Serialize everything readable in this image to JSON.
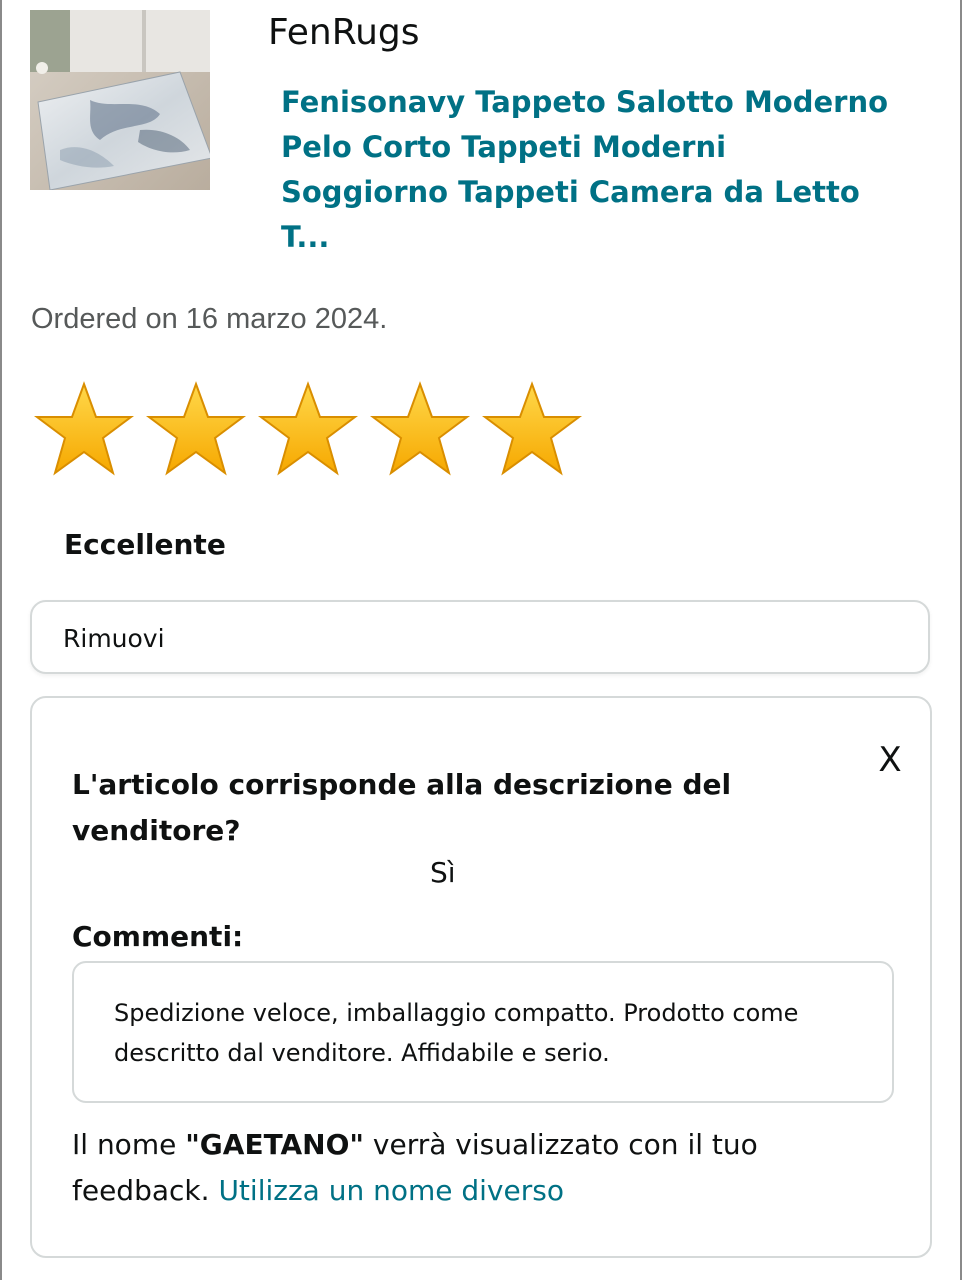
{
  "product": {
    "seller": "FenRugs",
    "title": "Fenisonavy Tappeto Salotto Moderno Pelo Corto Tappeti Moderni Soggiorno Tappeti Camera da Letto T..."
  },
  "order": {
    "date_text": "Ordered on 16 marzo 2024."
  },
  "rating": {
    "value": 5,
    "max": 5,
    "label": "Eccellente",
    "star_color": "#FFB400"
  },
  "actions": {
    "remove_label": "Rimuovi"
  },
  "feedback": {
    "close_label": "X",
    "question": "L'articolo corrisponde alla descrizione del venditore?",
    "answer": "Sì",
    "comments_label": "Commenti:",
    "comment_text": "Spedizione veloce, imballaggio compatto. Prodotto come descritto dal venditore. Affidabile e serio.",
    "name_prefix": "Il nome ",
    "name_value": "\"GAETANO\"",
    "name_suffix": " verrà visualizzato con il tuo feedback. ",
    "change_name_link": "Utilizza un nome diverso"
  },
  "colors": {
    "link": "#007185",
    "text": "#0f1111",
    "muted": "#565959",
    "border": "#d5d9d9"
  }
}
